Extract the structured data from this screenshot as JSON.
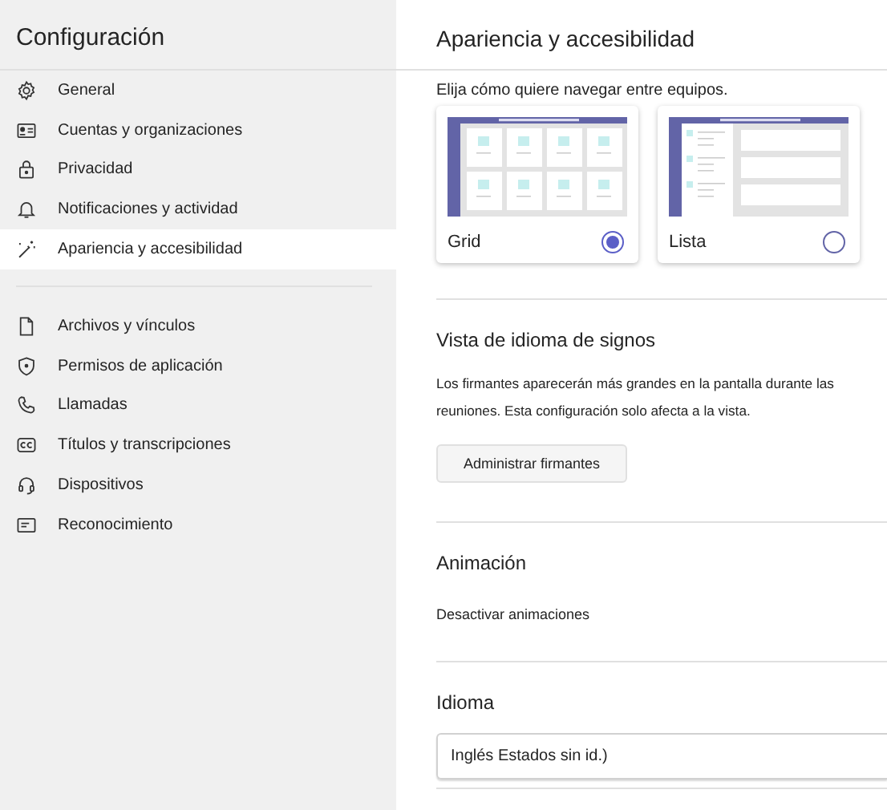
{
  "sidebar": {
    "title": "Configuración",
    "groups": [
      {
        "items": [
          {
            "label": "General",
            "selected": false
          },
          {
            "label": "Cuentas y organizaciones",
            "selected": false
          },
          {
            "label": "Privacidad",
            "selected": false
          },
          {
            "label": "Notificaciones y actividad",
            "selected": false
          },
          {
            "label": "Apariencia y accesibilidad",
            "selected": true
          }
        ]
      },
      {
        "items": [
          {
            "label": "Archivos y vínculos",
            "selected": false
          },
          {
            "label": "Permisos de aplicación",
            "selected": false
          },
          {
            "label": "Llamadas",
            "selected": false
          },
          {
            "label": "Títulos y transcripciones",
            "selected": false
          },
          {
            "label": "Dispositivos",
            "selected": false
          },
          {
            "label": "Reconocimiento",
            "selected": false
          }
        ]
      }
    ]
  },
  "main": {
    "title": "Apariencia y accesibilidad",
    "layout": {
      "prompt": "Elija cómo quiere navegar entre equipos.",
      "options": [
        {
          "label": "Grid",
          "kind": "grid",
          "selected": true
        },
        {
          "label": "Lista",
          "kind": "list",
          "selected": false
        }
      ]
    },
    "sign_language": {
      "heading": "Vista de idioma de signos",
      "description": "Los firmantes aparecerán más grandes en la pantalla durante las reuniones. Esta configuración solo afecta a la vista.",
      "button": "Administrar firmantes"
    },
    "animation": {
      "heading": "Animación",
      "label": "Desactivar animaciones"
    },
    "language": {
      "heading": "Idioma",
      "value": "Inglés Estados sin id.)"
    }
  }
}
